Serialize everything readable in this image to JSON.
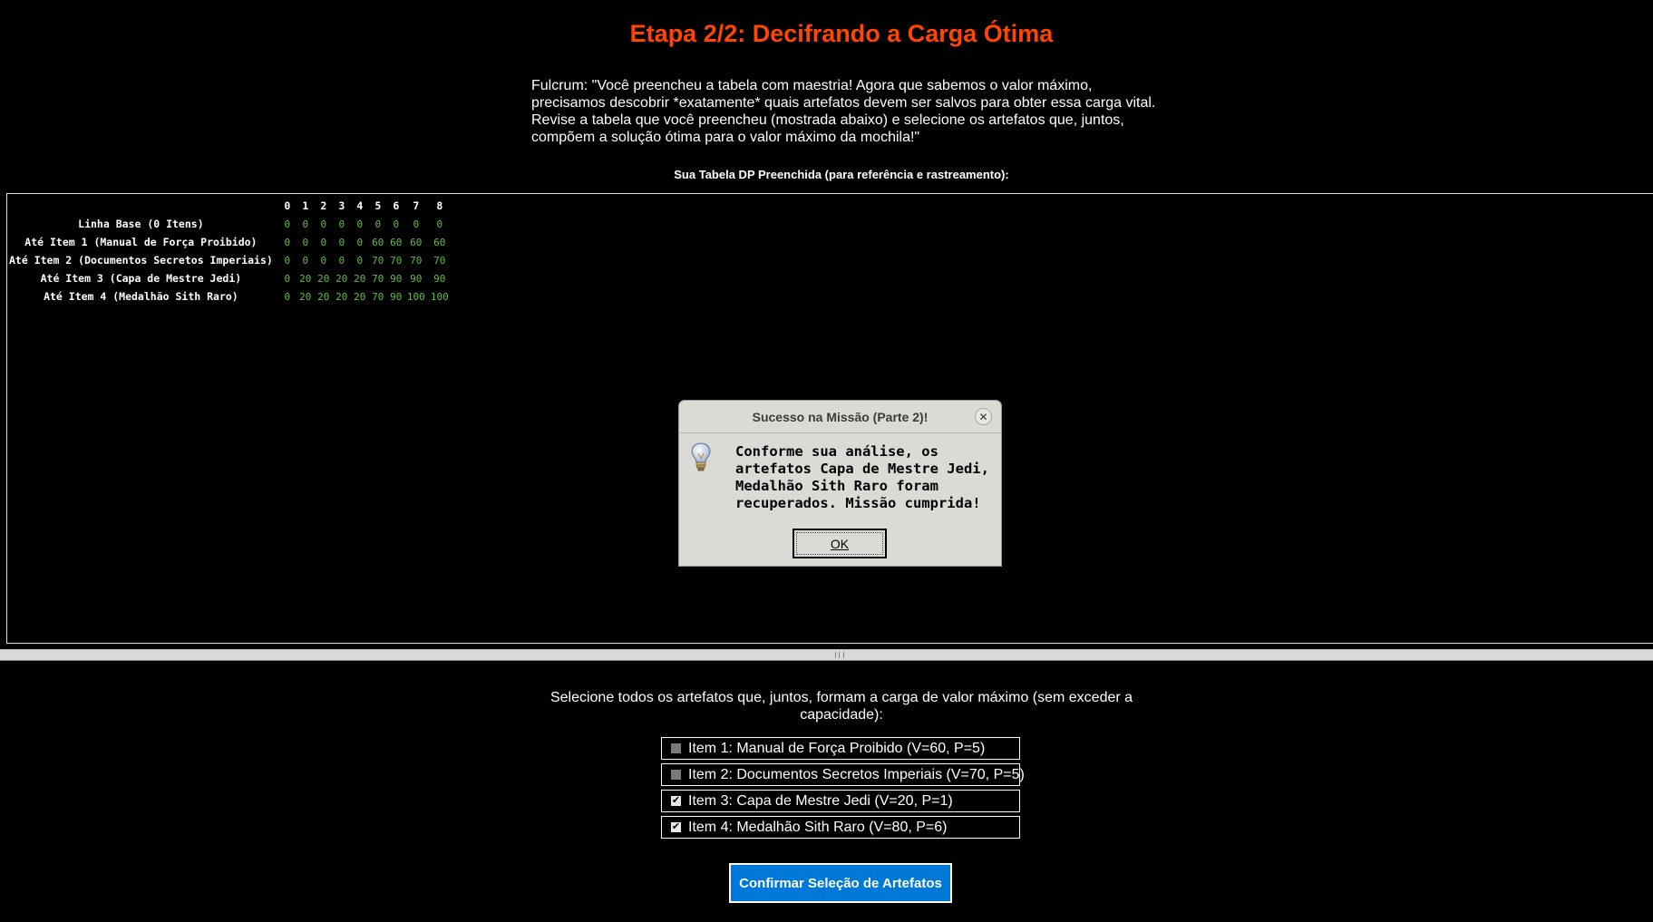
{
  "header": {
    "title": "Etapa 2/2: Decifrando a Carga Ótima",
    "intro_lines": [
      "Fulcrum: \"Você preencheu a tabela com maestria! Agora que sabemos o valor máximo,",
      "precisamos descobrir *exatamente* quais artefatos devem ser salvos para obter essa carga vital.",
      "Revise a tabela que você preencheu (mostrada abaixo) e selecione os artefatos que, juntos,",
      "compõem a solução ótima para o valor máximo da mochila!\""
    ]
  },
  "dp_table": {
    "caption": "Sua Tabela DP Preenchida (para referência e rastreamento):",
    "columns": [
      "0",
      "1",
      "2",
      "3",
      "4",
      "5",
      "6",
      "7",
      "8"
    ],
    "rows": [
      {
        "label": "Linha Base (0 Itens)",
        "values": [
          "0",
          "0",
          "0",
          "0",
          "0",
          "0",
          "0",
          "0",
          "0"
        ]
      },
      {
        "label": "Até Item 1 (Manual de Força Proibido)",
        "values": [
          "0",
          "0",
          "0",
          "0",
          "0",
          "60",
          "60",
          "60",
          "60"
        ]
      },
      {
        "label": "Até Item 2 (Documentos Secretos Imperiais)",
        "values": [
          "0",
          "0",
          "0",
          "0",
          "0",
          "70",
          "70",
          "70",
          "70"
        ]
      },
      {
        "label": "Até Item 3 (Capa de Mestre Jedi)",
        "values": [
          "0",
          "20",
          "20",
          "20",
          "20",
          "70",
          "90",
          "90",
          "90"
        ]
      },
      {
        "label": "Até Item 4 (Medalhão Sith Raro)",
        "values": [
          "0",
          "20",
          "20",
          "20",
          "20",
          "70",
          "90",
          "100",
          "100"
        ]
      }
    ]
  },
  "selection": {
    "prompt_lines": [
      "Selecione todos os artefatos que, juntos, formam a carga de valor máximo (sem exceder a",
      "capacidade):"
    ],
    "items": [
      {
        "label": "Item 1: Manual de Força Proibido (V=60, P=5)",
        "checked": false
      },
      {
        "label": "Item 2: Documentos Secretos Imperiais (V=70, P=5)",
        "checked": false
      },
      {
        "label": "Item 3: Capa de Mestre Jedi (V=20, P=1)",
        "checked": true
      },
      {
        "label": "Item 4: Medalhão Sith Raro (V=80, P=6)",
        "checked": true
      }
    ],
    "confirm_label": "Confirmar Seleção de Artefatos"
  },
  "dialog": {
    "title": "Sucesso na Missão (Parte 2)!",
    "message_lines": [
      "Conforme sua análise, os",
      "artefatos Capa de Mestre Jedi,",
      "Medalhão Sith Raro foram",
      "recuperados. Missão cumprida!"
    ],
    "ok_label": "OK",
    "icon": "lightbulb-icon"
  },
  "colors": {
    "title": "#ff4500",
    "table_values": "#5cbf3f",
    "confirm_button": "#0078d7",
    "dialog_bg": "#dcdad5"
  }
}
